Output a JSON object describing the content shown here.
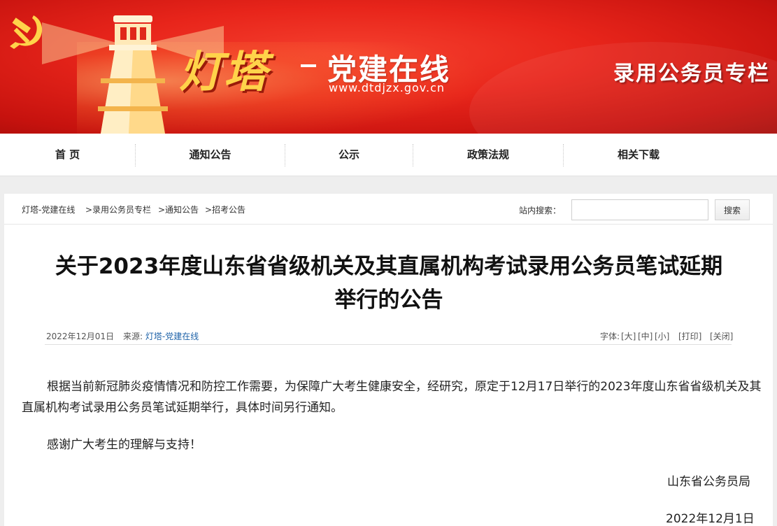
{
  "banner": {
    "logo_text": "灯塔",
    "site_name": "党建在线",
    "site_url": "www.dtdjzx.gov.cn",
    "column_title": "录用公务员专栏",
    "colors": {
      "banner_red": "#e8251b",
      "logo_gold": "#ffd34a"
    }
  },
  "nav": {
    "items": [
      {
        "label": "首 页"
      },
      {
        "label": "通知公告"
      },
      {
        "label": "公示"
      },
      {
        "label": "政策法规"
      },
      {
        "label": "相关下载"
      }
    ]
  },
  "breadcrumb": {
    "items": [
      {
        "label": "灯塔-党建在线"
      },
      {
        "label": ">录用公务员专栏"
      },
      {
        "label": ">通知公告"
      },
      {
        "label": ">招考公告"
      }
    ]
  },
  "search": {
    "label": "站内搜索：",
    "value": "",
    "placeholder": "",
    "button_label": "搜索"
  },
  "article": {
    "title_line1": "关于2023年度山东省省级机关及其直属机构考试录用公务员笔试延期",
    "title_line2": "举行的公告",
    "date": "2022年12月01日",
    "source_label": "来源:",
    "source_name": "灯塔-党建在线",
    "font_label": "字体:",
    "font_large": "[大]",
    "font_medium": "[中]",
    "font_small": "[小]",
    "print_label": "[打印]",
    "close_label": "[关闭]",
    "paragraph1": "根据当前新冠肺炎疫情情况和防控工作需要，为保障广大考生健康安全，经研究，原定于12月17日举行的2023年度山东省省级机关及其直属机构考试录用公务员笔试延期举行，具体时间另行通知。",
    "paragraph2": "感谢广大考生的理解与支持！",
    "sign_org": "山东省公务员局",
    "sign_date": "2022年12月1日"
  }
}
